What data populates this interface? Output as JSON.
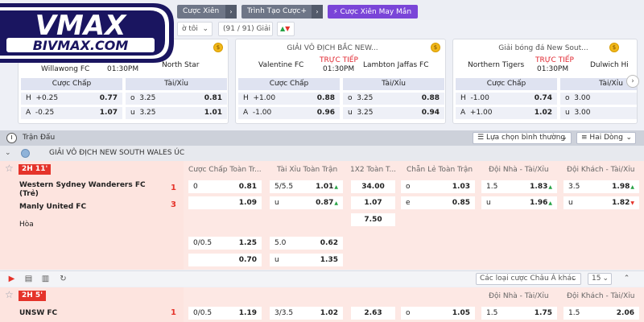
{
  "brand": {
    "logo_top": "VMAX",
    "logo_bottom": "BIVMAX.COM"
  },
  "topbar": {
    "tab1": "Cược Xiên",
    "tab2": "Trình Tạo Cược+",
    "tab3": "Cược Xiên May Mắn",
    "arrow": "›"
  },
  "filters": {
    "time_label": "ờ tôi",
    "count_label": "(91 / 91) Giải"
  },
  "cards": [
    {
      "league": "",
      "teamA": "Willawong FC",
      "teamB": "North Star",
      "time": "01:30PM",
      "live": "",
      "hdr_hcap": "Cược Chấp",
      "hdr_ou": "Tài/Xỉu",
      "rows": [
        {
          "hl": "H",
          "hv": "+0.25",
          "ho": "0.77",
          "ol": "o",
          "ov": "3.25",
          "oo": "0.81"
        },
        {
          "hl": "A",
          "hv": "-0.25",
          "ho": "1.07",
          "ol": "u",
          "ov": "3.25",
          "oo": "1.01"
        }
      ]
    },
    {
      "league": "GIẢI VÔ ĐỊCH BẮC NEW...",
      "teamA": "Valentine FC",
      "teamB": "Lambton Jaffas FC",
      "time": "01:30PM",
      "live": "TRỰC TIẾP",
      "hdr_hcap": "Cược Chấp",
      "hdr_ou": "Tài/Xỉu",
      "rows": [
        {
          "hl": "H",
          "hv": "+1.00",
          "ho": "0.88",
          "ol": "o",
          "ov": "3.25",
          "oo": "0.88"
        },
        {
          "hl": "A",
          "hv": "-1.00",
          "ho": "0.96",
          "ol": "u",
          "ov": "3.25",
          "oo": "0.94"
        }
      ]
    },
    {
      "league": "Giải bóng đá New Sout...",
      "teamA": "Northern Tigers",
      "teamB": "Dulwich Hi",
      "time": "01:30PM",
      "live": "TRỰC TIẾP",
      "hdr_hcap": "Cược Chấp",
      "hdr_ou": "Tài/Xỉu",
      "rows": [
        {
          "hl": "H",
          "hv": "-1.00",
          "ho": "0.74",
          "ol": "o",
          "ov": "3.00",
          "oo": ""
        },
        {
          "hl": "A",
          "hv": "+1.00",
          "ho": "1.02",
          "ol": "u",
          "ov": "3.00",
          "oo": ""
        }
      ]
    }
  ],
  "section": {
    "title": "Trận Đấu",
    "sort_label": "Lựa chọn bình thường",
    "lines_label": "Hai Dòng"
  },
  "league": {
    "name": "GIẢI VÔ ĐỊCH NEW SOUTH WALES ÚC"
  },
  "columns": {
    "c1": "Cược Chấp Toàn Tr...",
    "c2": "Tài Xỉu Toàn Trận",
    "c3": "1X2 Toàn T...",
    "c4": "Chẵn Lẻ Toàn Trận",
    "c5": "Đội Nhà - Tài/Xỉu",
    "c6": "Đội Khách - Tài/Xỉu"
  },
  "match1": {
    "badge": "2H 11'",
    "home": "Western Sydney Wanderers FC (Trẻ)",
    "away": "Manly United FC",
    "draw": "Hòa",
    "home_score": "1",
    "away_score": "3",
    "hcap": [
      {
        "l": "0",
        "r": "0.81"
      },
      {
        "l": "",
        "r": "1.09"
      }
    ],
    "ou": [
      {
        "l": "5/5.5",
        "r": "1.01"
      },
      {
        "l": "u",
        "r": "0.87"
      }
    ],
    "x12": [
      "34.00",
      "1.07",
      "7.50"
    ],
    "oe": [
      {
        "l": "o",
        "r": "1.03"
      },
      {
        "l": "e",
        "r": "0.85"
      }
    ],
    "home_ou": [
      {
        "l": "1.5",
        "r": "1.83"
      },
      {
        "l": "u",
        "r": "1.96"
      }
    ],
    "away_ou": [
      {
        "l": "3.5",
        "r": "1.98"
      },
      {
        "l": "u",
        "r": "1.82"
      }
    ],
    "alt_hcap": [
      {
        "l": "0/0.5",
        "r": "1.25"
      },
      {
        "l": "",
        "r": "0.70"
      }
    ],
    "alt_ou": [
      {
        "l": "5.0",
        "r": "0.62"
      },
      {
        "l": "u",
        "r": "1.35"
      }
    ]
  },
  "toolbar": {
    "bet_type": "Các loại cược Châu Á khác",
    "page_size": "15"
  },
  "match2": {
    "badge": "2H 5'",
    "home": "UNSW FC",
    "home_score": "1",
    "hcap": {
      "l": "0/0.5",
      "r": "1.19"
    },
    "ou": {
      "l": "3/3.5",
      "r": "1.02"
    },
    "x12": "2.63",
    "oe": {
      "l": "o",
      "r": "1.05"
    },
    "home_ou": {
      "l": "1.5",
      "r": "1.75"
    },
    "away_ou": {
      "l": "1.5",
      "r": "2.06"
    },
    "c5": "Đội Nhà - Tài/Xỉu",
    "c6": "Đội Khách - Tài/Xỉu"
  }
}
